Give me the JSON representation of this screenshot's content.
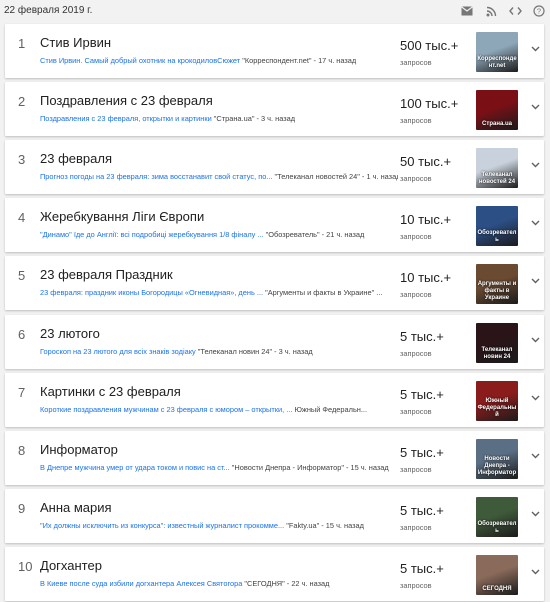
{
  "header": {
    "date": "22 февраля 2019 г.",
    "icons": [
      "email-icon",
      "rss-icon",
      "embed-code-icon",
      "help-icon"
    ]
  },
  "volume_label": "запросов",
  "trends": [
    {
      "rank": "1",
      "title": "Стив Ирвин",
      "link": "Стив Ирвин. Самый добрый охотник на крокодиловСюжет",
      "source": "\"Корреспондент.net\" - 17 ч. назад",
      "volume": "500 тыс.+",
      "thumb_caption": "Корреспонде нт.net",
      "thumb_color": "#8da6b8"
    },
    {
      "rank": "2",
      "title": "Поздравления с 23 февраля",
      "link": "Поздравления с 23 февраля, открытки и картинки",
      "source": "\"Страна.ua\" - 3 ч. назад",
      "volume": "100 тыс.+",
      "thumb_caption": "Страна.ua",
      "thumb_color": "#7a1016"
    },
    {
      "rank": "3",
      "title": "23 февраля",
      "link": "Прогноз погоды на 23 февраля: зима восстанавит свой статус, по...",
      "source": "\"Телеканал новостей 24\" - 1 ч. назад",
      "volume": "50 тыс.+",
      "thumb_caption": "Телеканал новостей 24",
      "thumb_color": "#c9d2dc"
    },
    {
      "rank": "4",
      "title": "Жеребкування Ліги Європи",
      "link": "\"Динамо\" їде до Англії: всі подробиці жеребкування 1/8 фіналу ...",
      "source": "\"Обозреватель\" - 21 ч. назад",
      "volume": "10 тыс.+",
      "thumb_caption": "Обозревател ь",
      "thumb_color": "#2c4f86"
    },
    {
      "rank": "5",
      "title": "23 февраля Праздник",
      "link": "23 февраля: праздник иконы Богородицы «Огневидная», день ...",
      "source": "\"Аргументы и факты в Украине\" ...",
      "volume": "10 тыс.+",
      "thumb_caption": "Аргументы и факты в Украине",
      "thumb_color": "#6b4a32"
    },
    {
      "rank": "6",
      "title": "23 лютого",
      "link": "Гороскоп на 23 лютого для всіх знаків зодіаку",
      "source": "\"Телеканал новин 24\" - 3 ч. назад",
      "volume": "5 тыс.+",
      "thumb_caption": "Телеканал новин 24",
      "thumb_color": "#2a1418"
    },
    {
      "rank": "7",
      "title": "Картинки с 23 февраля",
      "link": "Короткие поздравления мужчинам с 23 февраля с юмором – открытки, ...",
      "source": "Южный Федеральн...",
      "volume": "5 тыс.+",
      "thumb_caption": "Южный Федеральны й",
      "thumb_color": "#8b1c1c"
    },
    {
      "rank": "8",
      "title": "Информатор",
      "link": "В Днепре мужчина умер от удара током и повис на ст...",
      "source": "\"Новости Днепра - Информатор\" - 15 ч. назад",
      "volume": "5 тыс.+",
      "thumb_caption": "Новости Днепра - Информатор",
      "thumb_color": "#5a6f84"
    },
    {
      "rank": "9",
      "title": "Анна мария",
      "link": "\"Их должны исключить из конкурса\": известный журналист прокомме...",
      "source": "\"Fakty.ua\" - 15 ч. назад",
      "volume": "5 тыс.+",
      "thumb_caption": "Обозревател ь",
      "thumb_color": "#3f5a3a"
    },
    {
      "rank": "10",
      "title": "Догхантер",
      "link": "В Киеве после суда избили догхантера Алексея Святогора",
      "source": "\"СЕГОДНЯ\" - 22 ч. назад",
      "volume": "5 тыс.+",
      "thumb_caption": "СЕГОДНЯ",
      "thumb_color": "#8a6a5a"
    }
  ],
  "colors": {
    "link": "#1a73e8",
    "background": "#f2f2f2"
  }
}
